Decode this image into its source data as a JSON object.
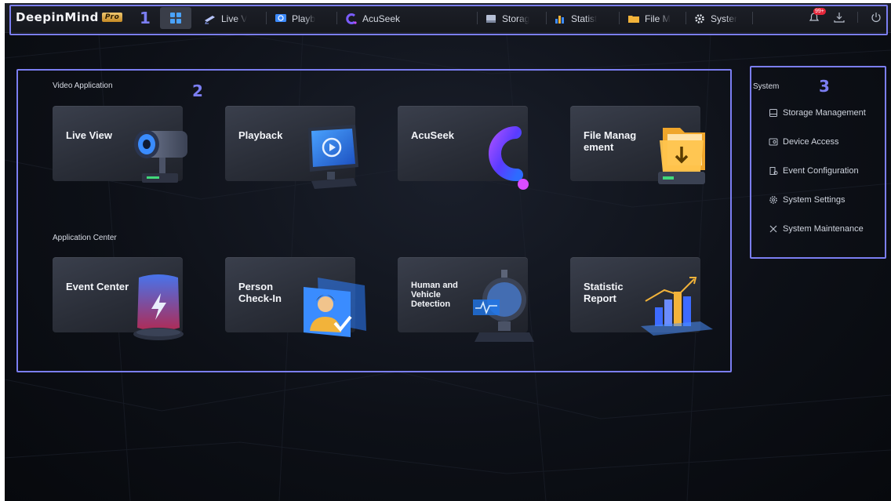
{
  "app": {
    "logo_text": "DeepinMind",
    "logo_badge": "Pro"
  },
  "annotations": [
    "1",
    "2",
    "3"
  ],
  "nav": {
    "tabs": [
      {
        "label": "Live V",
        "icon": "camera-icon"
      },
      {
        "label": "Playb",
        "icon": "playback-icon"
      },
      {
        "label": "AcuSeek",
        "icon": "acuseek-icon"
      },
      {
        "label": "Storag",
        "icon": "storage-icon"
      },
      {
        "label": "Statist",
        "icon": "statistics-icon"
      },
      {
        "label": "File M",
        "icon": "folder-icon"
      },
      {
        "label": "Syster",
        "icon": "gear-icon"
      }
    ],
    "notification_badge": "99+"
  },
  "video_application": {
    "label": "Video Application",
    "cards": [
      {
        "title": "Live View",
        "icon": "camera-icon"
      },
      {
        "title": "Playback",
        "icon": "monitor-playback-icon"
      },
      {
        "title": "AcuSeek",
        "icon": "acuseek-logo-icon"
      },
      {
        "title": "File Manag ement",
        "icon": "file-folder-icon"
      }
    ]
  },
  "application_center": {
    "label": "Application Center",
    "cards": [
      {
        "title": "Event Center",
        "icon": "alarm-light-icon"
      },
      {
        "title": "Person Check-In",
        "icon": "person-checkin-icon"
      },
      {
        "title": "Human and Vehicle Detection",
        "icon": "detection-camera-icon"
      },
      {
        "title": "Statistic Report",
        "icon": "bar-chart-icon"
      }
    ]
  },
  "system": {
    "label": "System",
    "items": [
      {
        "label": "Storage Management",
        "icon": "storage-icon"
      },
      {
        "label": "Device Access",
        "icon": "device-icon"
      },
      {
        "label": "Event Configuration",
        "icon": "event-config-icon"
      },
      {
        "label": "System Settings",
        "icon": "gear-icon"
      },
      {
        "label": "System Maintenance",
        "icon": "tools-icon"
      }
    ]
  },
  "colors": {
    "annotation": "#7b7ef2",
    "accent_blue": "#4aa3ff",
    "badge_red": "#e3263a"
  }
}
